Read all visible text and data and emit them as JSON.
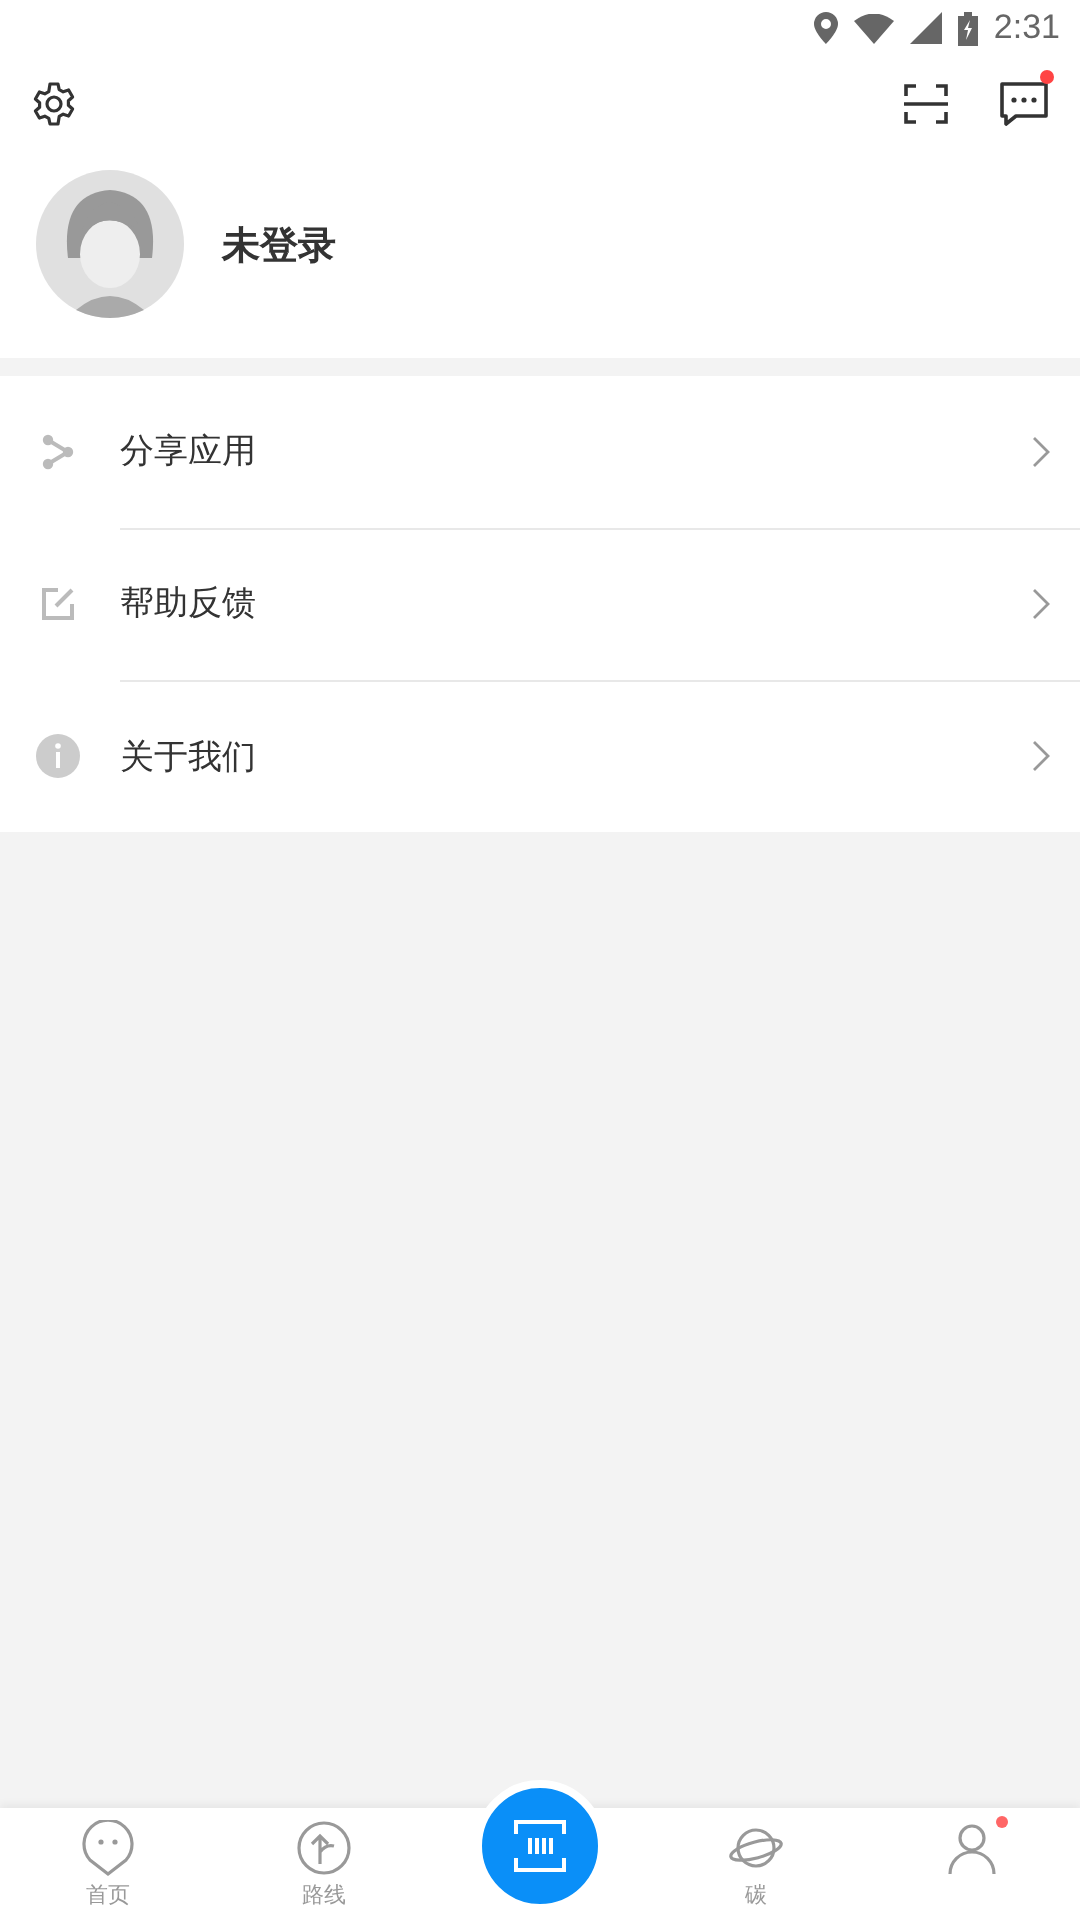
{
  "status_bar": {
    "time": "2:31"
  },
  "header": {
    "message_dot": true
  },
  "profile": {
    "name": "未登录"
  },
  "menu": [
    {
      "label": "分享应用"
    },
    {
      "label": "帮助反馈"
    },
    {
      "label": "关于我们"
    }
  ],
  "bottom_nav": [
    {
      "kind": "tab",
      "label": "首页",
      "selected": false
    },
    {
      "kind": "tab",
      "label": "路线",
      "selected": false
    },
    {
      "kind": "scan",
      "selected": false
    },
    {
      "kind": "tab",
      "label": "碳",
      "selected": false
    },
    {
      "kind": "tab",
      "dot": true,
      "selected": false
    }
  ]
}
